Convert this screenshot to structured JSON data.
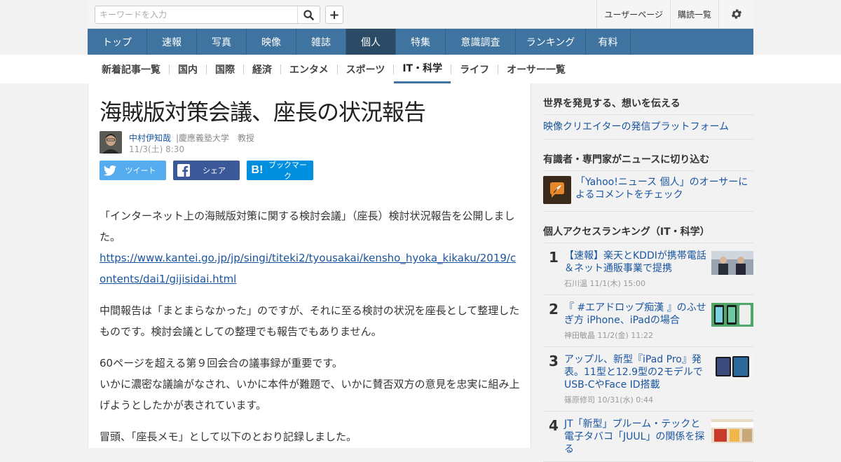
{
  "topbar": {
    "search_placeholder": "キーワードを入力",
    "links": [
      "ユーザーページ",
      "購読一覧"
    ]
  },
  "mainnav": [
    {
      "label": "トップ",
      "active": false
    },
    {
      "label": "速報",
      "active": false
    },
    {
      "label": "写真",
      "active": false
    },
    {
      "label": "映像",
      "active": false
    },
    {
      "label": "雑誌",
      "active": false
    },
    {
      "label": "個人",
      "active": true
    },
    {
      "label": "特集",
      "active": false
    },
    {
      "label": "意識調査",
      "active": false
    },
    {
      "label": "ランキング",
      "active": false
    },
    {
      "label": "有料",
      "active": false
    }
  ],
  "subnav": [
    {
      "label": "新着記事一覧",
      "active": false
    },
    {
      "label": "国内",
      "active": false
    },
    {
      "label": "国際",
      "active": false
    },
    {
      "label": "経済",
      "active": false
    },
    {
      "label": "エンタメ",
      "active": false
    },
    {
      "label": "スポーツ",
      "active": false
    },
    {
      "label": "IT・科学",
      "active": true
    },
    {
      "label": "ライフ",
      "active": false
    },
    {
      "label": "オーサー一覧",
      "active": false
    }
  ],
  "article": {
    "title": "海賊版対策会議、座長の状況報告",
    "author_name": "中村伊知哉",
    "author_affiliation": "|慶應義塾大学　教授",
    "date": "11/3(土) 8:30",
    "share": {
      "tweet": "ツイート",
      "facebook": "シェア",
      "hatena": "ブックマーク"
    },
    "paragraphs": [
      {
        "text": "「インターネット上の海賊版対策に関する検討会議」（座長）検討状況報告を公開しました。",
        "link": "https://www.kantei.go.jp/jp/singi/titeki2/tyousakai/kensho_hyoka_kikaku/2019/contents/dai1/gijisidai.html"
      },
      {
        "text": "中間報告は「まとまらなかった」のですが、それに至る検討の状況を座長として整理したものです。検討会議としての整理でも報告でもありません。",
        "link": ""
      },
      {
        "text": "60ページを超える第９回会合の議事録が重要です。",
        "text2": "いかに濃密な議論がなされ、いかに本件が難題で、いかに賛否双方の意見を忠実に組み上げようとしたかが表されています。",
        "link": ""
      },
      {
        "text": "冒頭、「座長メモ」として以下のとおり記録しました。",
        "link": ""
      }
    ]
  },
  "sidebar": {
    "sec1_head": "世界を発見する、想いを伝える",
    "sec1_link": "映像クリエイターの発信プラットフォーム",
    "sec2_head": "有識者・専門家がニュースに切り込む",
    "sec2_text": "「Yahoo!ニュース 個人」のオーサーによるコメントをチェック",
    "ranking_head": "個人アクセスランキング（IT・科学）",
    "ranking": [
      {
        "num": "1",
        "title": "【速報】楽天とKDDIが携帯電話＆ネット通販事業で提携",
        "meta": "石川温  11/1(木) 15:00"
      },
      {
        "num": "2",
        "title": "『 #エアドロップ痴漢 』のふせぎ方 iPhone、iPadの場合",
        "meta": "神田敏晶  11/2(金) 11:22"
      },
      {
        "num": "3",
        "title": "アップル、新型『iPad Pro』発表。11型と12.9型の2モデルでUSB-CやFace ID搭載",
        "meta": "篠原修司  10/31(水) 0:44"
      },
      {
        "num": "4",
        "title": "JT「新型」プルーム・テックと電子タバコ「JUUL」の関係を探る",
        "meta": ""
      }
    ]
  },
  "colors": {
    "nav_bg": "#3f73a0",
    "nav_active": "#2b4a66",
    "link": "#1a55a0",
    "twitter": "#55acee",
    "facebook": "#3b5998",
    "hatena": "#008fde"
  }
}
